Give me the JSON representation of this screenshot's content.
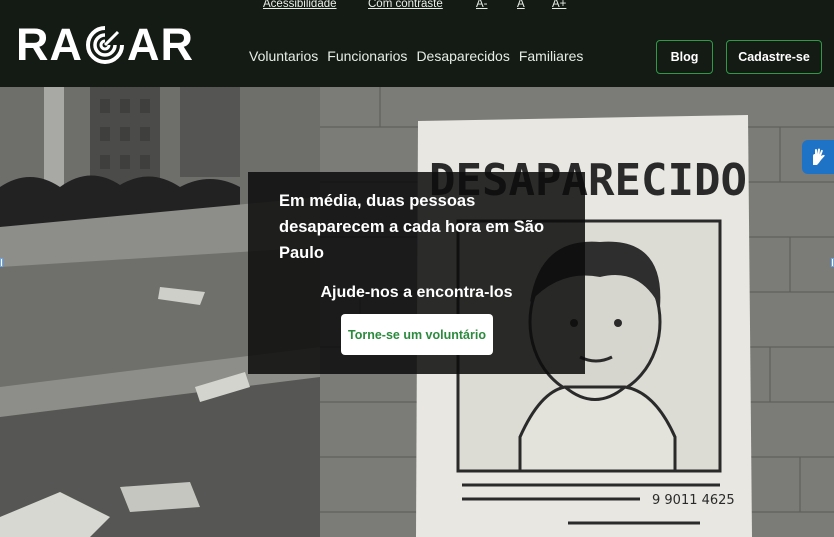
{
  "accessibility": {
    "accessibility_label": "Acessibilidade",
    "contrast_label": "Com contraste",
    "font_decrease": "A-",
    "font_reset": "A",
    "font_increase": "A+"
  },
  "brand": {
    "logo_left": "RA",
    "logo_right": "AR",
    "logo_icon": "radar-rings-icon"
  },
  "nav": {
    "items": [
      "Voluntarios",
      "Funcionarios",
      "Desaparecidos",
      "Familiares"
    ]
  },
  "header_buttons": {
    "blog": "Blog",
    "signup": "Cadastre-se"
  },
  "hero": {
    "headline": "Em média, duas pessoas desaparecem a cada hora em São Paulo",
    "subheadline": "Ajude-nos a encontra-los",
    "cta": "Torne-se um voluntário",
    "poster_title": "DESAPARECIDO",
    "poster_phone": "9 9011 4625"
  },
  "widgets": {
    "libras_icon": "sign-language-hand-icon"
  },
  "colors": {
    "header_bg": "#141a14",
    "accent_green": "#2f9a46",
    "cta_text": "#2b8a3e",
    "libras_blue": "#1f73c7"
  }
}
